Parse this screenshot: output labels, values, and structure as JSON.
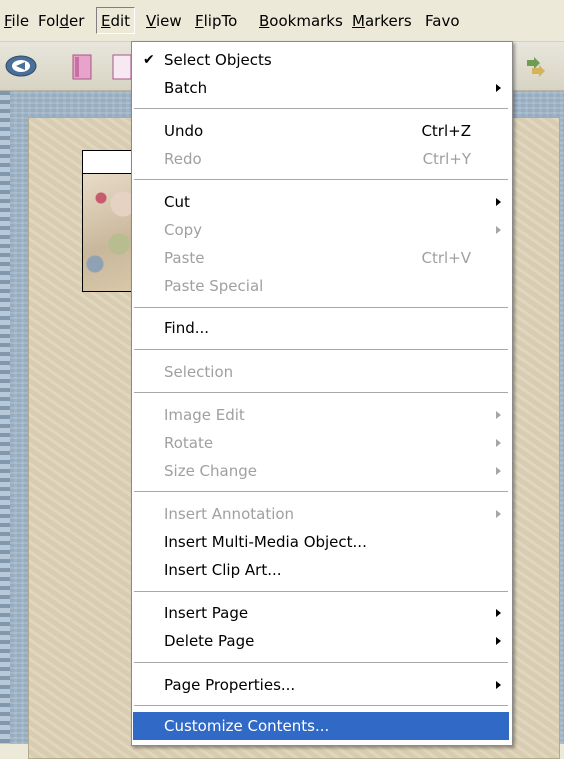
{
  "menubar": {
    "items": [
      {
        "label": "File",
        "accel": "F",
        "rest": "ile"
      },
      {
        "label": "Folder",
        "pre": "Fol",
        "accel": "d",
        "rest": "er"
      },
      {
        "label": "Edit",
        "accel": "E",
        "rest": "dit"
      },
      {
        "label": "View",
        "accel": "V",
        "rest": "iew"
      },
      {
        "label": "FlipTo",
        "accel": "F",
        "rest": "lipTo"
      },
      {
        "label": "Bookmarks",
        "accel": "B",
        "rest": "ookmarks"
      },
      {
        "label": "Markers",
        "accel": "M",
        "rest": "arkers"
      },
      {
        "label": "Favorites (cut off)",
        "text": "Favo"
      }
    ]
  },
  "edit_menu": {
    "select_objects": {
      "label": "Select Objects",
      "checked": true
    },
    "batch": {
      "label": "Batch"
    },
    "undo": {
      "label": "Undo",
      "shortcut": "Ctrl+Z"
    },
    "redo": {
      "label": "Redo",
      "shortcut": "Ctrl+Y"
    },
    "cut": {
      "label": "Cut"
    },
    "copy": {
      "label": "Copy"
    },
    "paste": {
      "label": "Paste",
      "shortcut": "Ctrl+V"
    },
    "paste_special": {
      "label": "Paste Special"
    },
    "find": {
      "label": "Find..."
    },
    "selection": {
      "label": "Selection"
    },
    "image_edit": {
      "label": "Image Edit"
    },
    "rotate": {
      "label": "Rotate"
    },
    "size_change": {
      "label": "Size Change"
    },
    "insert_annotation": {
      "label": "Insert Annotation"
    },
    "insert_multimedia": {
      "label": "Insert Multi-Media Object..."
    },
    "insert_clip_art": {
      "label": "Insert Clip Art..."
    },
    "insert_page": {
      "label": "Insert Page"
    },
    "delete_page": {
      "label": "Delete Page"
    },
    "page_properties": {
      "label": "Page Properties..."
    },
    "customize_contents": {
      "label": "Customize Contents..."
    }
  },
  "colors": {
    "highlight": "#3169c6",
    "disabled_text": "#a0a0a0",
    "menubar_bg": "#ece9d8",
    "workspace_bg": "#9fb6c9",
    "page_bg": "#ddd2b6"
  }
}
